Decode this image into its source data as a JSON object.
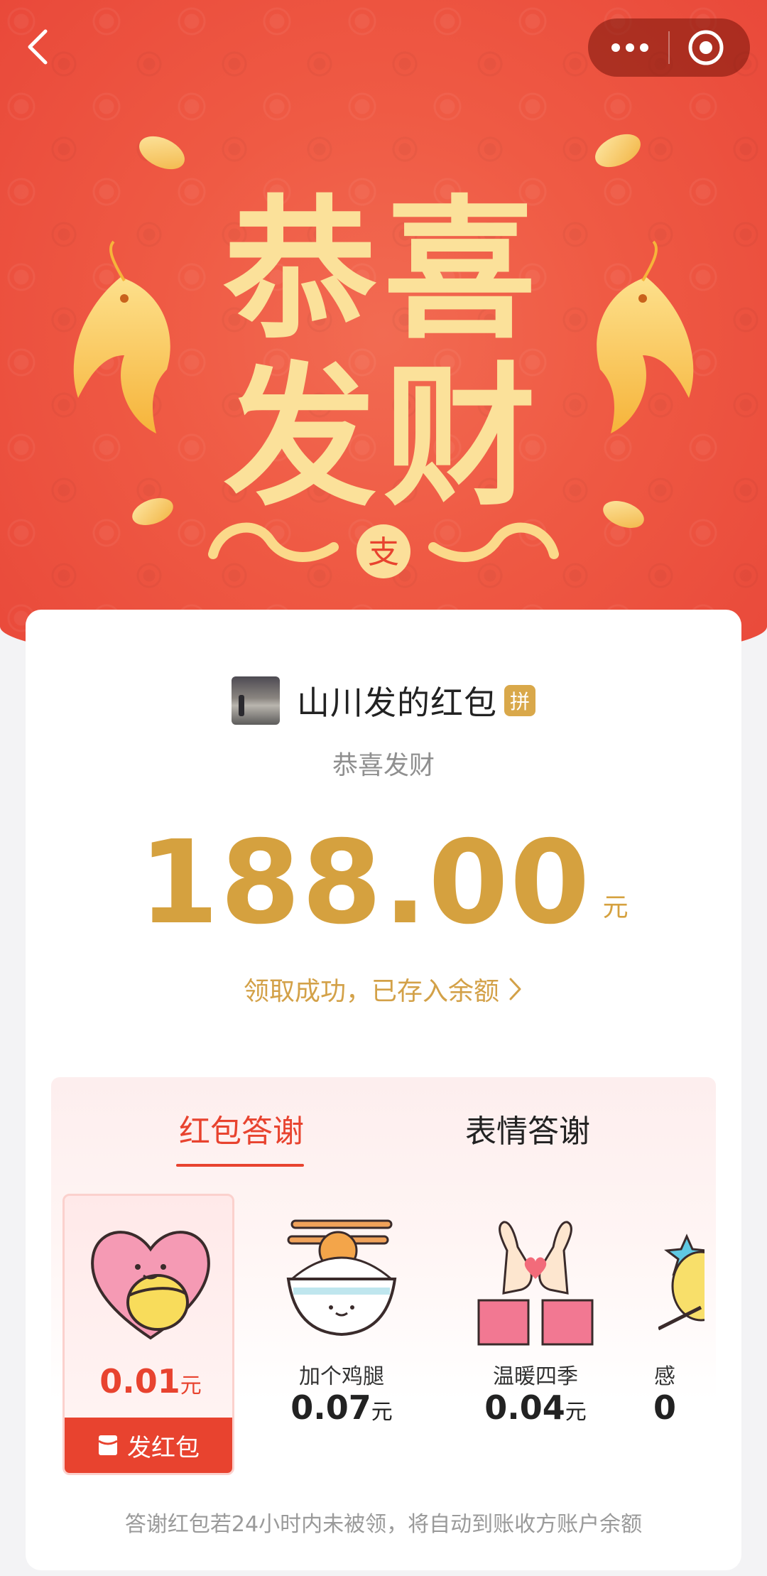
{
  "banner": {
    "title_line1": "恭喜",
    "title_line2": "发财",
    "seal_char": "支"
  },
  "nav": {
    "back_icon": "chevron-left-icon",
    "more_icon": "more-dots-icon",
    "close_icon": "target-close-icon"
  },
  "sender": {
    "name": "山川发的红包",
    "badge": "拼"
  },
  "greeting": "恭喜发财",
  "amount": {
    "value": "188.00",
    "unit": "元"
  },
  "received_text": "领取成功，已存入余额",
  "tabs": [
    {
      "label": "红包答谢",
      "active": true
    },
    {
      "label": "表情答谢",
      "active": false
    }
  ],
  "gifts": [
    {
      "name": "",
      "price": "0.01",
      "unit": "元",
      "icon": "heart-hug-icon",
      "selected": true,
      "action": "发红包"
    },
    {
      "name": "加个鸡腿",
      "price": "0.07",
      "unit": "元",
      "icon": "rice-bowl-drumstick-icon"
    },
    {
      "name": "温暖四季",
      "price": "0.04",
      "unit": "元",
      "icon": "heart-hands-icon"
    },
    {
      "name": "感",
      "price": "0",
      "unit": "",
      "icon": "star-chick-icon"
    }
  ],
  "footer_note": "答谢红包若24小时内未被领，将自动到账收方账户余额",
  "colors": {
    "banner_red": "#ef5a44",
    "gold": "#d5a13f",
    "accent_red": "#e8432f",
    "title_yellow": "#fbe19a"
  }
}
